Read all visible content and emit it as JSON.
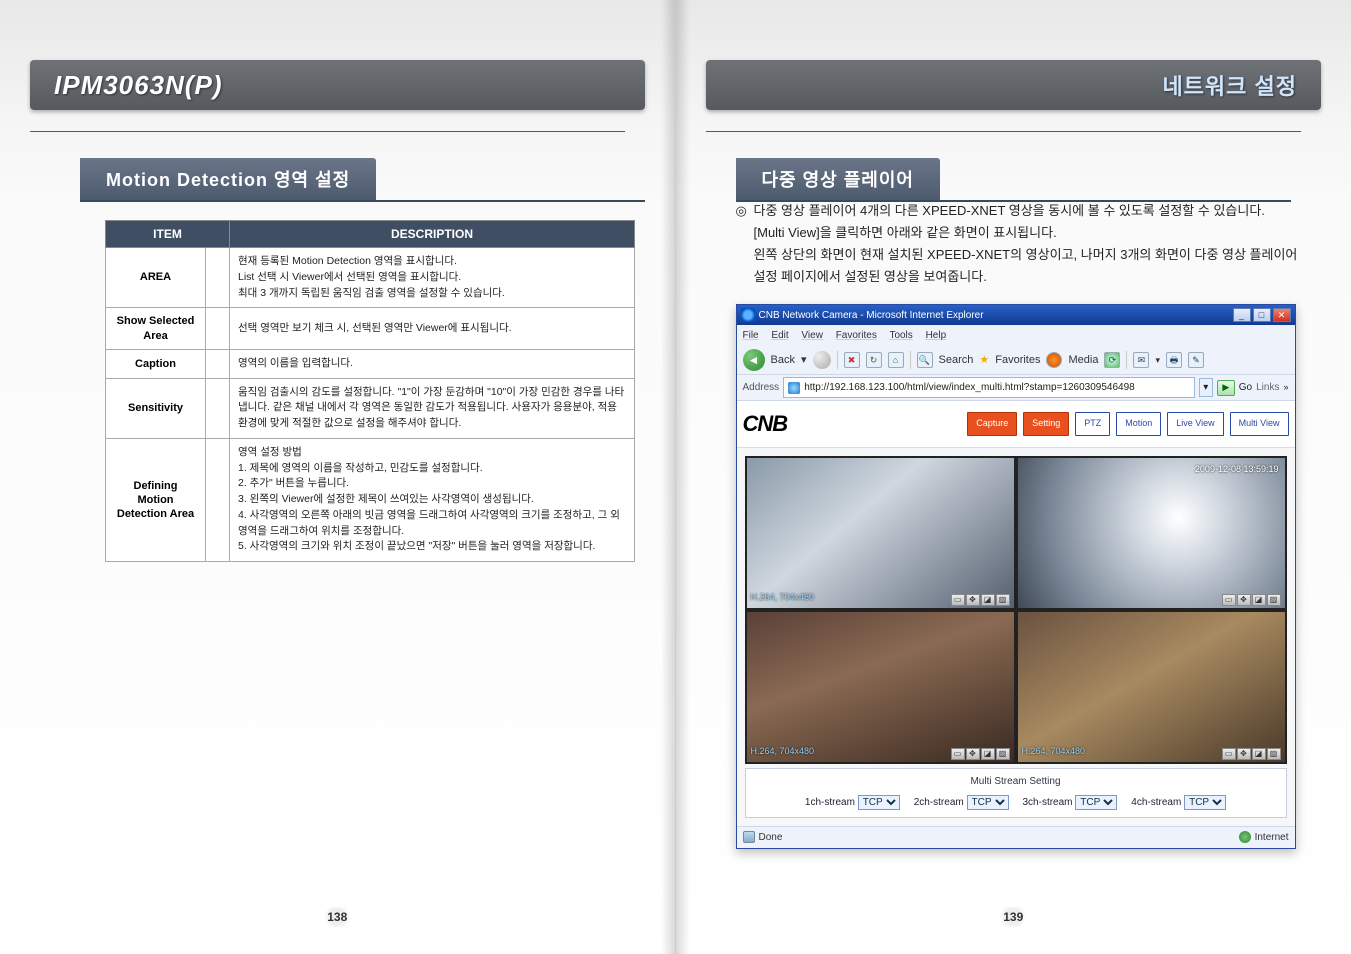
{
  "product": "IPM3063N(P)",
  "network_settings_label": "네트워크 설정",
  "left": {
    "section_title": "Motion Detection 영역 설정",
    "table": {
      "headers": {
        "item": "ITEM",
        "desc": "DESCRIPTION"
      },
      "rows": [
        {
          "item": "AREA",
          "desc": "현재 등록된 Motion Detection 영역을 표시합니다.\nList 선택 시 Viewer에서 선택된 영역을 표시합니다.\n최대 3 개까지 독립된 움직임 검출 영역을 설정할 수 있습니다."
        },
        {
          "item": "Show Selected Area",
          "desc": "선택 영역만 보기 체크 시, 선택된 영역만 Viewer에 표시됩니다."
        },
        {
          "item": "Caption",
          "desc": "영역의 이름을 입력합니다."
        },
        {
          "item": "Sensitivity",
          "desc": "움직임 검출시의 감도를 설정합니다. \"1\"이 가장 둔감하며 \"10\"이 가장 민감한 경우를 나타냅니다. 같은 채널 내에서 각 영역은 동일한 감도가 적용됩니다. 사용자가 응용분야, 적용 환경에 맞게 적절한 값으로 설정을 해주셔야 합니다."
        },
        {
          "item": "Defining Motion Detection Area",
          "desc": "영역 설정 방법\n1. 제목에 영역의 이름을 작성하고, 민감도를 설정합니다.\n2. 추가\" 버튼을 누릅니다.\n3. 왼쪽의 Viewer에 설정한 제목이 쓰여있는 사각영역이 생성됩니다.\n4. 사각영역의 오른쪽 아래의 빗금 영역을 드래그하여 사각영역의 크기를 조정하고, 그 외 영역을 드래그하여 위치를 조정합니다.\n5. 사각영역의 크기와 위치 조정이 끝났으면 \"저장\" 버튼을 눌러 영역을 저장합니다."
        }
      ]
    },
    "page_number": "138"
  },
  "right": {
    "section_title": "다중 영상 플레이어",
    "intro_lines": [
      "다중 영상 플레이어 4개의 다른 XPEED-XNET 영상을 동시에 볼 수 있도록 설정할 수 있습니다.",
      "[Multi View]을 클릭하면 아래와 같은 화면이 표시됩니다.",
      "왼쪽 상단의 화면이 현재 설치된 XPEED-XNET의 영상이고, 나머지 3개의 화면이 다중 영상  플레이어 설정 페이지에서 설정된 영상을 보여줍니다."
    ],
    "ie": {
      "title": "CNB Network Camera - Microsoft Internet Explorer",
      "menu": [
        "File",
        "Edit",
        "View",
        "Favorites",
        "Tools",
        "Help"
      ],
      "toolbar": {
        "back": "Back",
        "search": "Search",
        "favorites": "Favorites",
        "media": "Media"
      },
      "address_label": "Address",
      "address": "http://192.168.123.100/html/view/index_multi.html?stamp=1260309546498",
      "go": "Go",
      "links": "Links",
      "status_done": "Done",
      "status_zone": "Internet"
    },
    "cnb": {
      "logo": "CNB",
      "buttons": {
        "capture": "Capture",
        "setting": "Setting",
        "ptz": "PTZ",
        "motion": "Motion",
        "liveview": "Live View",
        "multiview": "Multi View"
      }
    },
    "video": {
      "cells": [
        {
          "label": "H.264, 704x480",
          "ts": ""
        },
        {
          "label": "",
          "ts": "2009-12-08 13:59:19"
        },
        {
          "label": "H.264, 704x480",
          "ts": ""
        },
        {
          "label": "H.264, 704x480",
          "ts": ""
        }
      ]
    },
    "mstream": {
      "title": "Multi Stream Setting",
      "channels": [
        {
          "label": "1ch-stream",
          "value": "TCP"
        },
        {
          "label": "2ch-stream",
          "value": "TCP"
        },
        {
          "label": "3ch-stream",
          "value": "TCP"
        },
        {
          "label": "4ch-stream",
          "value": "TCP"
        }
      ]
    },
    "page_number": "139"
  }
}
